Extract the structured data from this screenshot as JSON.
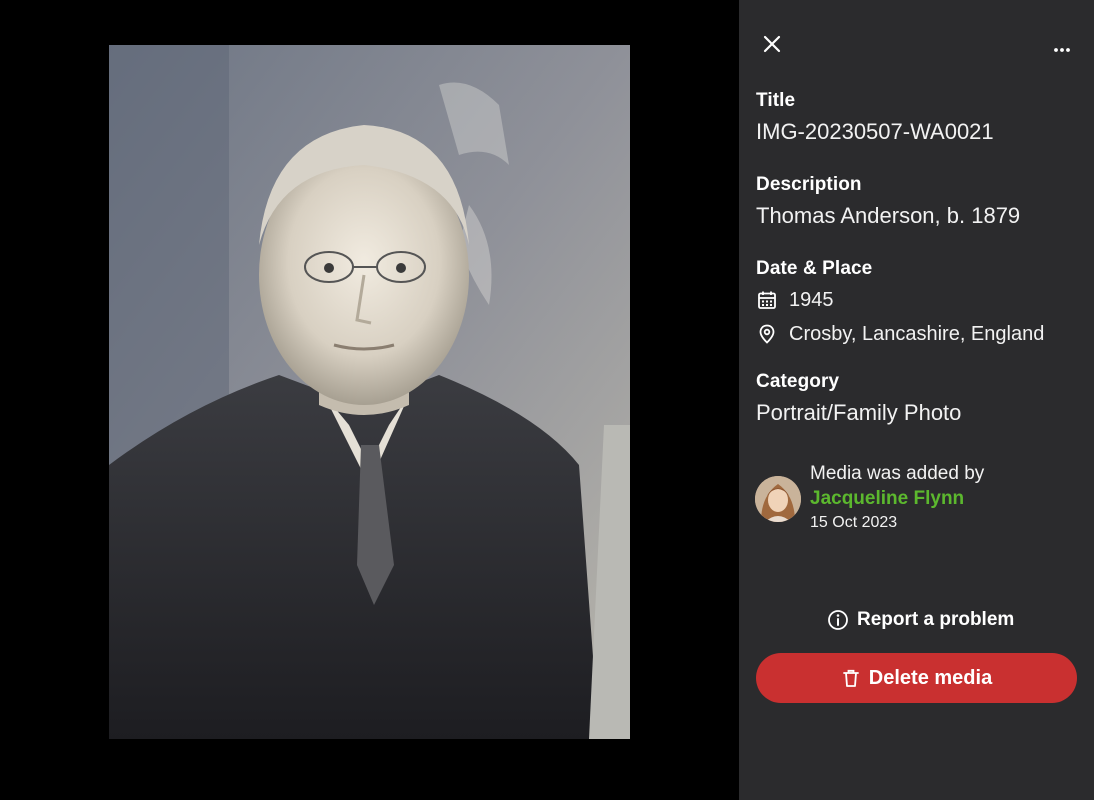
{
  "photo": {
    "alt": "Portrait photograph"
  },
  "panel": {
    "close_icon": "close-icon",
    "more_icon": "more-icon",
    "title_label": "Title",
    "title_value": "IMG-20230507-WA0021",
    "description_label": "Description",
    "description_value": "Thomas Anderson, b. 1879",
    "date_place_label": "Date & Place",
    "date_value": "1945",
    "place_value": "Crosby, Lancashire, England",
    "category_label": "Category",
    "category_value": "Portrait/Family Photo",
    "added_by_text": "Media was added by",
    "added_by_name": "Jacqueline Flynn",
    "added_date": "15 Oct 2023",
    "report_label": "Report a problem",
    "delete_label": "Delete media"
  },
  "colors": {
    "panel_bg": "#2b2b2d",
    "accent_green": "#5cb82e",
    "delete_red": "#c93030"
  }
}
